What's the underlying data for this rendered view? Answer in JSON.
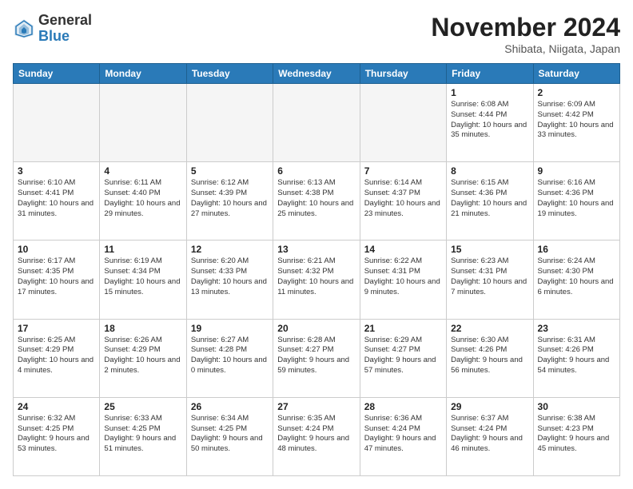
{
  "logo": {
    "general": "General",
    "blue": "Blue"
  },
  "header": {
    "title": "November 2024",
    "subtitle": "Shibata, Niigata, Japan"
  },
  "weekdays": [
    "Sunday",
    "Monday",
    "Tuesday",
    "Wednesday",
    "Thursday",
    "Friday",
    "Saturday"
  ],
  "weeks": [
    [
      {
        "day": "",
        "info": "",
        "empty": true
      },
      {
        "day": "",
        "info": "",
        "empty": true
      },
      {
        "day": "",
        "info": "",
        "empty": true
      },
      {
        "day": "",
        "info": "",
        "empty": true
      },
      {
        "day": "",
        "info": "",
        "empty": true
      },
      {
        "day": "1",
        "info": "Sunrise: 6:08 AM\nSunset: 4:44 PM\nDaylight: 10 hours and 35 minutes."
      },
      {
        "day": "2",
        "info": "Sunrise: 6:09 AM\nSunset: 4:42 PM\nDaylight: 10 hours and 33 minutes."
      }
    ],
    [
      {
        "day": "3",
        "info": "Sunrise: 6:10 AM\nSunset: 4:41 PM\nDaylight: 10 hours and 31 minutes."
      },
      {
        "day": "4",
        "info": "Sunrise: 6:11 AM\nSunset: 4:40 PM\nDaylight: 10 hours and 29 minutes."
      },
      {
        "day": "5",
        "info": "Sunrise: 6:12 AM\nSunset: 4:39 PM\nDaylight: 10 hours and 27 minutes."
      },
      {
        "day": "6",
        "info": "Sunrise: 6:13 AM\nSunset: 4:38 PM\nDaylight: 10 hours and 25 minutes."
      },
      {
        "day": "7",
        "info": "Sunrise: 6:14 AM\nSunset: 4:37 PM\nDaylight: 10 hours and 23 minutes."
      },
      {
        "day": "8",
        "info": "Sunrise: 6:15 AM\nSunset: 4:36 PM\nDaylight: 10 hours and 21 minutes."
      },
      {
        "day": "9",
        "info": "Sunrise: 6:16 AM\nSunset: 4:36 PM\nDaylight: 10 hours and 19 minutes."
      }
    ],
    [
      {
        "day": "10",
        "info": "Sunrise: 6:17 AM\nSunset: 4:35 PM\nDaylight: 10 hours and 17 minutes."
      },
      {
        "day": "11",
        "info": "Sunrise: 6:19 AM\nSunset: 4:34 PM\nDaylight: 10 hours and 15 minutes."
      },
      {
        "day": "12",
        "info": "Sunrise: 6:20 AM\nSunset: 4:33 PM\nDaylight: 10 hours and 13 minutes."
      },
      {
        "day": "13",
        "info": "Sunrise: 6:21 AM\nSunset: 4:32 PM\nDaylight: 10 hours and 11 minutes."
      },
      {
        "day": "14",
        "info": "Sunrise: 6:22 AM\nSunset: 4:31 PM\nDaylight: 10 hours and 9 minutes."
      },
      {
        "day": "15",
        "info": "Sunrise: 6:23 AM\nSunset: 4:31 PM\nDaylight: 10 hours and 7 minutes."
      },
      {
        "day": "16",
        "info": "Sunrise: 6:24 AM\nSunset: 4:30 PM\nDaylight: 10 hours and 6 minutes."
      }
    ],
    [
      {
        "day": "17",
        "info": "Sunrise: 6:25 AM\nSunset: 4:29 PM\nDaylight: 10 hours and 4 minutes."
      },
      {
        "day": "18",
        "info": "Sunrise: 6:26 AM\nSunset: 4:29 PM\nDaylight: 10 hours and 2 minutes."
      },
      {
        "day": "19",
        "info": "Sunrise: 6:27 AM\nSunset: 4:28 PM\nDaylight: 10 hours and 0 minutes."
      },
      {
        "day": "20",
        "info": "Sunrise: 6:28 AM\nSunset: 4:27 PM\nDaylight: 9 hours and 59 minutes."
      },
      {
        "day": "21",
        "info": "Sunrise: 6:29 AM\nSunset: 4:27 PM\nDaylight: 9 hours and 57 minutes."
      },
      {
        "day": "22",
        "info": "Sunrise: 6:30 AM\nSunset: 4:26 PM\nDaylight: 9 hours and 56 minutes."
      },
      {
        "day": "23",
        "info": "Sunrise: 6:31 AM\nSunset: 4:26 PM\nDaylight: 9 hours and 54 minutes."
      }
    ],
    [
      {
        "day": "24",
        "info": "Sunrise: 6:32 AM\nSunset: 4:25 PM\nDaylight: 9 hours and 53 minutes."
      },
      {
        "day": "25",
        "info": "Sunrise: 6:33 AM\nSunset: 4:25 PM\nDaylight: 9 hours and 51 minutes."
      },
      {
        "day": "26",
        "info": "Sunrise: 6:34 AM\nSunset: 4:25 PM\nDaylight: 9 hours and 50 minutes."
      },
      {
        "day": "27",
        "info": "Sunrise: 6:35 AM\nSunset: 4:24 PM\nDaylight: 9 hours and 48 minutes."
      },
      {
        "day": "28",
        "info": "Sunrise: 6:36 AM\nSunset: 4:24 PM\nDaylight: 9 hours and 47 minutes."
      },
      {
        "day": "29",
        "info": "Sunrise: 6:37 AM\nSunset: 4:24 PM\nDaylight: 9 hours and 46 minutes."
      },
      {
        "day": "30",
        "info": "Sunrise: 6:38 AM\nSunset: 4:23 PM\nDaylight: 9 hours and 45 minutes."
      }
    ]
  ]
}
